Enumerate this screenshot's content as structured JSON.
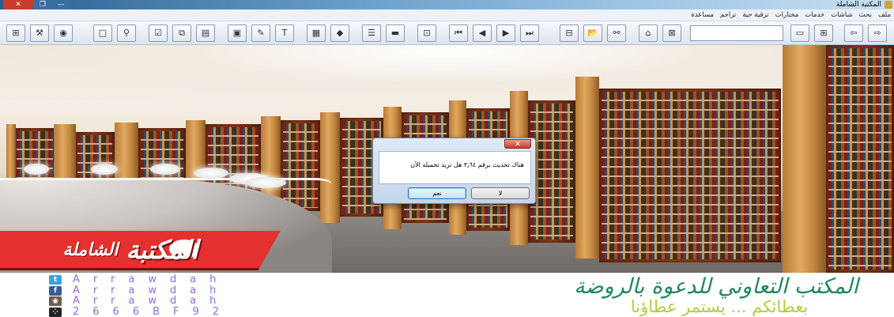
{
  "window": {
    "title": "المكتبة الشاملة",
    "controls": {
      "close": "✕",
      "maximize": "❐",
      "minimize": "—"
    }
  },
  "menu": [
    "ملف",
    "بحث",
    "شاشات",
    "خدمات",
    "مختارات",
    "ترقية حية",
    "تراجم",
    "مساعدة"
  ],
  "toolbar": {
    "buttons_left": [
      {
        "name": "search-all-icon",
        "glyph": "⊞"
      },
      {
        "name": "tools-icon",
        "glyph": "⚒"
      },
      {
        "name": "pill-icon",
        "glyph": "◉"
      },
      {
        "name": "new-page-icon",
        "glyph": "□"
      },
      {
        "name": "find-replace-icon",
        "glyph": "⚲"
      },
      {
        "name": "check-icon",
        "glyph": "☑"
      },
      {
        "name": "copy-icon",
        "glyph": "⧉"
      },
      {
        "name": "book-icon",
        "glyph": "▤"
      },
      {
        "name": "note-icon",
        "glyph": "▣"
      },
      {
        "name": "pen-icon",
        "glyph": "✎"
      },
      {
        "name": "text-icon",
        "glyph": "T"
      },
      {
        "name": "bookmark-icon",
        "glyph": "▦"
      },
      {
        "name": "red-marker-icon",
        "glyph": "◆"
      },
      {
        "name": "list-icon",
        "glyph": "☰"
      },
      {
        "name": "bar-icon",
        "glyph": "▬"
      },
      {
        "name": "window-icon",
        "glyph": "⊡"
      },
      {
        "name": "first-page-icon",
        "glyph": "⏮"
      },
      {
        "name": "previous-page-icon",
        "glyph": "◀"
      },
      {
        "name": "next-page-icon",
        "glyph": "▶"
      },
      {
        "name": "last-page-icon",
        "glyph": "⏭"
      },
      {
        "name": "table-icon",
        "glyph": "⊟"
      },
      {
        "name": "open-folder-icon",
        "glyph": "📂"
      },
      {
        "name": "binoculars-icon",
        "glyph": "⚯"
      },
      {
        "name": "library-icon",
        "glyph": "⌂"
      },
      {
        "name": "sheet-icon",
        "glyph": "⊠"
      }
    ],
    "buttons_right": [
      {
        "name": "folder-icon",
        "glyph": "▭"
      },
      {
        "name": "layout-icon",
        "glyph": "⊞"
      },
      {
        "name": "back-arrow-icon",
        "glyph": "⇦"
      },
      {
        "name": "forward-arrow-icon",
        "glyph": "⇨"
      }
    ],
    "search_value": ""
  },
  "banner": {
    "logo_main": "المكتبة",
    "logo_sub": "الشاملة"
  },
  "dialog": {
    "close_glyph": "✕",
    "message": "هناك تحديث برقم ٣٫٦٤ هل تريد تحميله الآن",
    "no_label": "لا",
    "yes_label": "نعم"
  },
  "footer": {
    "social": [
      {
        "name": "twitter-icon",
        "glyph": "t",
        "color": "#3aa3e3",
        "text": "Arrawdah"
      },
      {
        "name": "facebook-icon",
        "glyph": "f",
        "color": "#3b5998",
        "text": "Arrawdah"
      },
      {
        "name": "instagram-icon",
        "glyph": "◉",
        "color": "#6b5b4a",
        "text": "Arrawdah"
      },
      {
        "name": "blackberry-icon",
        "glyph": "⁘",
        "color": "#222222",
        "text": "2666BF92"
      }
    ],
    "org_name": "المكتب التعاوني للدعوة بالروضة",
    "slogan": "بعطائكم ... يستمر عطاؤنا"
  },
  "colors": {
    "logo_red": "#e53030",
    "org_green": "#1f8a5a",
    "slogan_green": "#b0cf3a",
    "social_text": "#8f6ed8"
  }
}
